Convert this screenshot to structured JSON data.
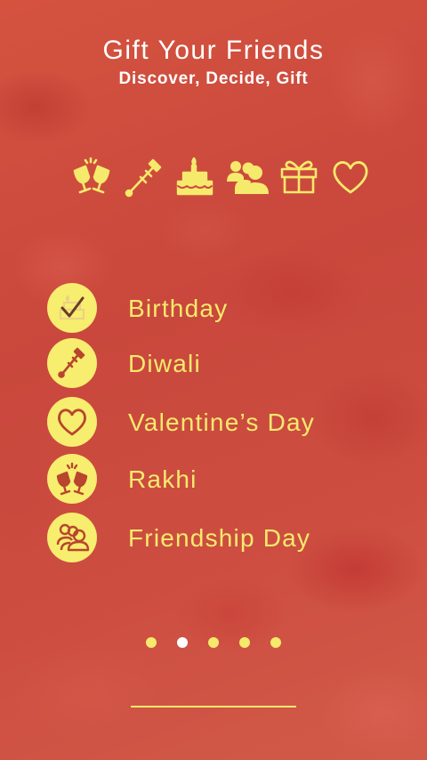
{
  "header": {
    "title": "Gift Your Friends",
    "subtitle": "Discover, Decide, Gift"
  },
  "icon_strip": [
    {
      "icon": "champagne-glasses-icon"
    },
    {
      "icon": "rocket-firework-icon"
    },
    {
      "icon": "birthday-cake-icon"
    },
    {
      "icon": "friends-group-icon"
    },
    {
      "icon": "gift-box-icon"
    },
    {
      "icon": "heart-icon"
    }
  ],
  "occasions": [
    {
      "label": "Birthday",
      "icon": "check-cake-icon",
      "selected": true
    },
    {
      "label": "Diwali",
      "icon": "rocket-firework-icon",
      "selected": false
    },
    {
      "label": "Valentine’s Day",
      "icon": "heart-icon",
      "selected": false
    },
    {
      "label": "Rakhi",
      "icon": "champagne-glasses-icon",
      "selected": false
    },
    {
      "label": "Friendship Day",
      "icon": "friends-group-icon",
      "selected": false
    }
  ],
  "pagination": {
    "pages": 5,
    "current_page": 2
  },
  "colors": {
    "accent_yellow": "#f6ea6c",
    "badge_yellow": "#f7ed6e",
    "icon_brown": "#b8452e",
    "background_red": "#cf4a3e",
    "active_dot": "#ffffff"
  }
}
